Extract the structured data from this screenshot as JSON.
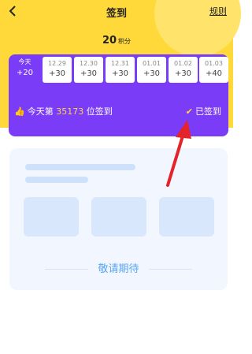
{
  "header": {
    "title": "签到",
    "rules_label": "规则",
    "points_value": "20",
    "points_unit": "积分"
  },
  "days": [
    {
      "date": "今天",
      "points": "+20"
    },
    {
      "date": "12.29",
      "points": "+30"
    },
    {
      "date": "12.30",
      "points": "+30"
    },
    {
      "date": "12.31",
      "points": "+30"
    },
    {
      "date": "01.01",
      "points": "+30"
    },
    {
      "date": "01.02",
      "points": "+30"
    },
    {
      "date": "01.03",
      "points": "+40"
    }
  ],
  "status": {
    "prefix": "今天第",
    "count": "35173",
    "suffix": "位签到",
    "signed_label": "已签到"
  },
  "placeholder": {
    "text": "敬请期待"
  },
  "colors": {
    "header_bg": "#ffd83a",
    "card_purple": "#7a3cf6",
    "arrow_red": "#e5232a",
    "accent_blue": "#5aa5f4"
  }
}
